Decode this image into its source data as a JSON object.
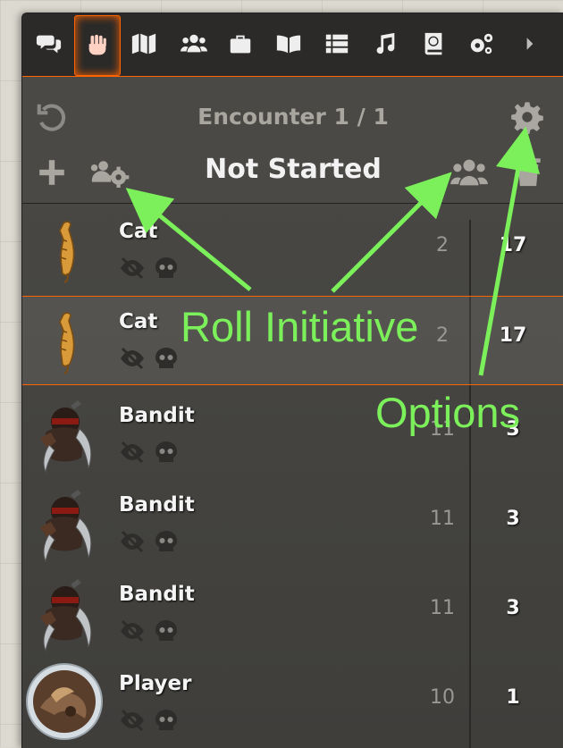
{
  "nav": {
    "items": [
      {
        "icon": "chat-icon"
      },
      {
        "icon": "combat-fist-icon",
        "active": true
      },
      {
        "icon": "map-icon"
      },
      {
        "icon": "users-icon"
      },
      {
        "icon": "briefcase-icon"
      },
      {
        "icon": "book-icon"
      },
      {
        "icon": "list-icon"
      },
      {
        "icon": "music-icon"
      },
      {
        "icon": "compendium-icon"
      },
      {
        "icon": "settings-icon"
      },
      {
        "icon": "caret-right-icon"
      }
    ]
  },
  "tracker": {
    "encounter_title": "Encounter 1 / 1",
    "status": "Not Started",
    "combatants": [
      {
        "name": "Cat",
        "token": "cat",
        "dex": "2",
        "initiative": "17",
        "active": false
      },
      {
        "name": "Cat",
        "token": "cat",
        "dex": "2",
        "initiative": "17",
        "active": true
      },
      {
        "name": "Bandit",
        "token": "bandit",
        "dex": "11",
        "initiative": "3",
        "active": false
      },
      {
        "name": "Bandit",
        "token": "bandit",
        "dex": "11",
        "initiative": "3",
        "active": false
      },
      {
        "name": "Bandit",
        "token": "bandit",
        "dex": "11",
        "initiative": "3",
        "active": false
      },
      {
        "name": "Player",
        "token": "player",
        "dex": "10",
        "initiative": "1",
        "active": false
      }
    ]
  },
  "annotations": {
    "roll_initiative": "Roll Initiative",
    "options": "Options",
    "color": "#7cf05a"
  },
  "colors": {
    "accent": "#ff6400",
    "panel": "#4a4946",
    "nav": "#2b2a28"
  }
}
